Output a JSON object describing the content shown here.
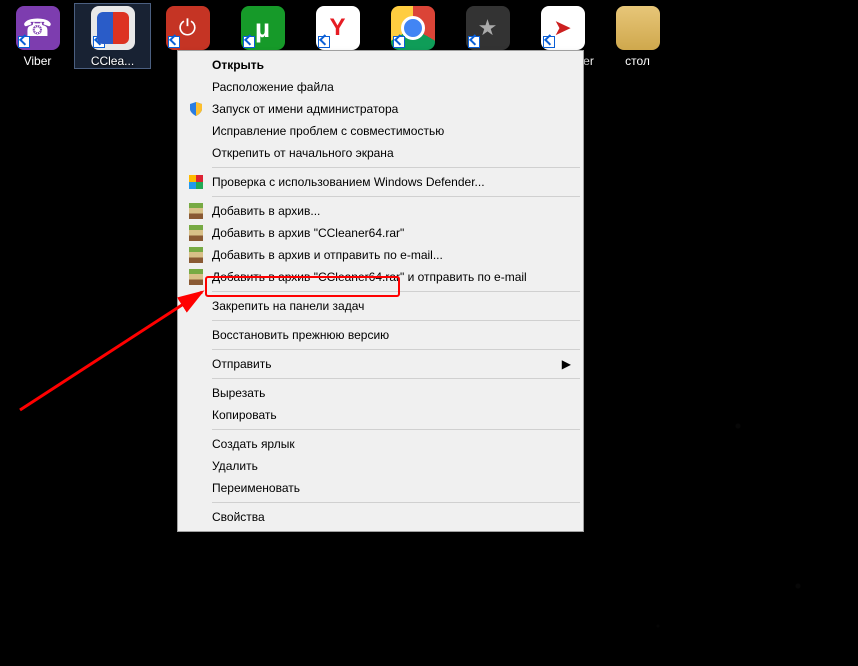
{
  "desktop_icons": [
    {
      "label": "Viber"
    },
    {
      "label": "CClea..."
    },
    {
      "label": ""
    },
    {
      "label": ""
    },
    {
      "label": ""
    },
    {
      "label": ""
    },
    {
      "label": ""
    },
    {
      "label": "ame Center"
    },
    {
      "label": "стол"
    }
  ],
  "menu": {
    "open": "Открыть",
    "file_location": "Расположение файла",
    "run_as_admin": "Запуск от имени администратора",
    "troubleshoot": "Исправление проблем с совместимостью",
    "unpin_start": "Открепить от начального экрана",
    "defender": "Проверка с использованием Windows Defender...",
    "add_archive": "Добавить в архив...",
    "add_archive_named": "Добавить в архив \"CCleaner64.rar\"",
    "add_archive_email": "Добавить в архив и отправить по e-mail...",
    "add_archive_named_email": "Добавить в архив \"CCleaner64.rar\" и отправить по e-mail",
    "pin_taskbar": "Закрепить на панели задач",
    "restore": "Восстановить прежнюю версию",
    "send_to": "Отправить",
    "cut": "Вырезать",
    "copy": "Копировать",
    "create_shortcut": "Создать ярлык",
    "delete": "Удалить",
    "rename": "Переименовать",
    "properties": "Свойства"
  },
  "annotation": {
    "highlighted_item": "pin_taskbar"
  }
}
